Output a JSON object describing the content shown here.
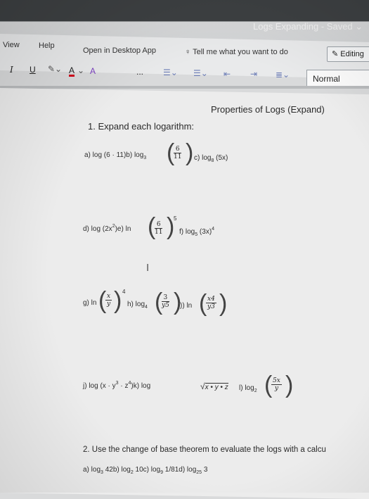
{
  "app": {
    "doc_title": "Logs Expanding - Saved",
    "menu": [
      "View",
      "Help",
      "Open in Desktop App",
      "Tell me what you want to do"
    ],
    "editing_label": "Editing",
    "style_value": "Normal"
  },
  "toolbar": {
    "italic": "I",
    "underline": "U",
    "font_color": "A",
    "clear_format": "A",
    "more": "..."
  },
  "document": {
    "heading": "Properties of Logs (Expand)",
    "q1": "1. Expand each logarithm:",
    "row1": {
      "a_prefix": "a) log (6 · 11)b) log",
      "a_base": "3",
      "frac_num": "6",
      "frac_den": "11",
      "c_text": "c) log",
      "c_base": "8",
      "c_arg": "(5x)"
    },
    "row2": {
      "d_text": "d) log (2x",
      "d_exp": "2",
      "d_rest": ")e) ln",
      "frac_num": "6",
      "frac_den": "11",
      "power": "5",
      "f_text": "f) log",
      "f_base": "5",
      "f_arg": "(3x)",
      "f_exp": "4"
    },
    "row3": {
      "g_text": "g) ln",
      "g_num": "x",
      "g_den": "y",
      "g_pow": "4",
      "h_text": "h) log",
      "h_base": "4",
      "h_num": "3",
      "h_den": "y5",
      "i_text": ")) ln",
      "i_num": "x4",
      "i_den": "y3"
    },
    "row4": {
      "j_text": "j) log (x · y",
      "j_exp1": "3",
      "j_mid": " · z",
      "j_exp2": "4",
      "j_rest": ")k) log",
      "sqrt_arg": "x • y • z",
      "l_text": "l) log",
      "l_base": "2",
      "l_num": "5x",
      "l_den": "y"
    },
    "q2": "2. Use the change of base theorem to evaluate the logs with a calcu",
    "q2_row": {
      "a": "a) log",
      "a_base": "3",
      "a_rest": " 42b) log",
      "b_base": "2",
      "b_rest": " 10c) log",
      "c_base": "9",
      "c_rest": " 1/81d) log",
      "d_base": "25",
      "d_rest": " 3"
    }
  }
}
